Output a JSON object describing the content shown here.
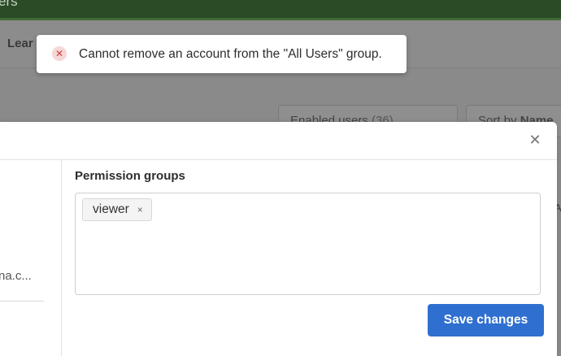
{
  "app": {
    "title_fragment": "ers"
  },
  "subnav": {
    "link_label": "Lear"
  },
  "filters": {
    "users_select": {
      "label": "Enabled users",
      "count": "(36)"
    },
    "sort_select": {
      "label": "Sort by",
      "value": "Name"
    }
  },
  "background": {
    "edge_char": "A"
  },
  "toast": {
    "icon": "x-circle-icon",
    "message": "Cannot remove an account from the \"All Users\" group.",
    "color": "#d23b3b"
  },
  "modal": {
    "close_icon": "close-icon",
    "left_panel": {
      "email_fragment": "na.c..."
    },
    "permission_groups": {
      "label": "Permission groups",
      "chips": [
        {
          "label": "viewer",
          "remove": "×"
        }
      ]
    },
    "save_button": {
      "label": "Save changes",
      "color": "#2f6fd0"
    }
  }
}
